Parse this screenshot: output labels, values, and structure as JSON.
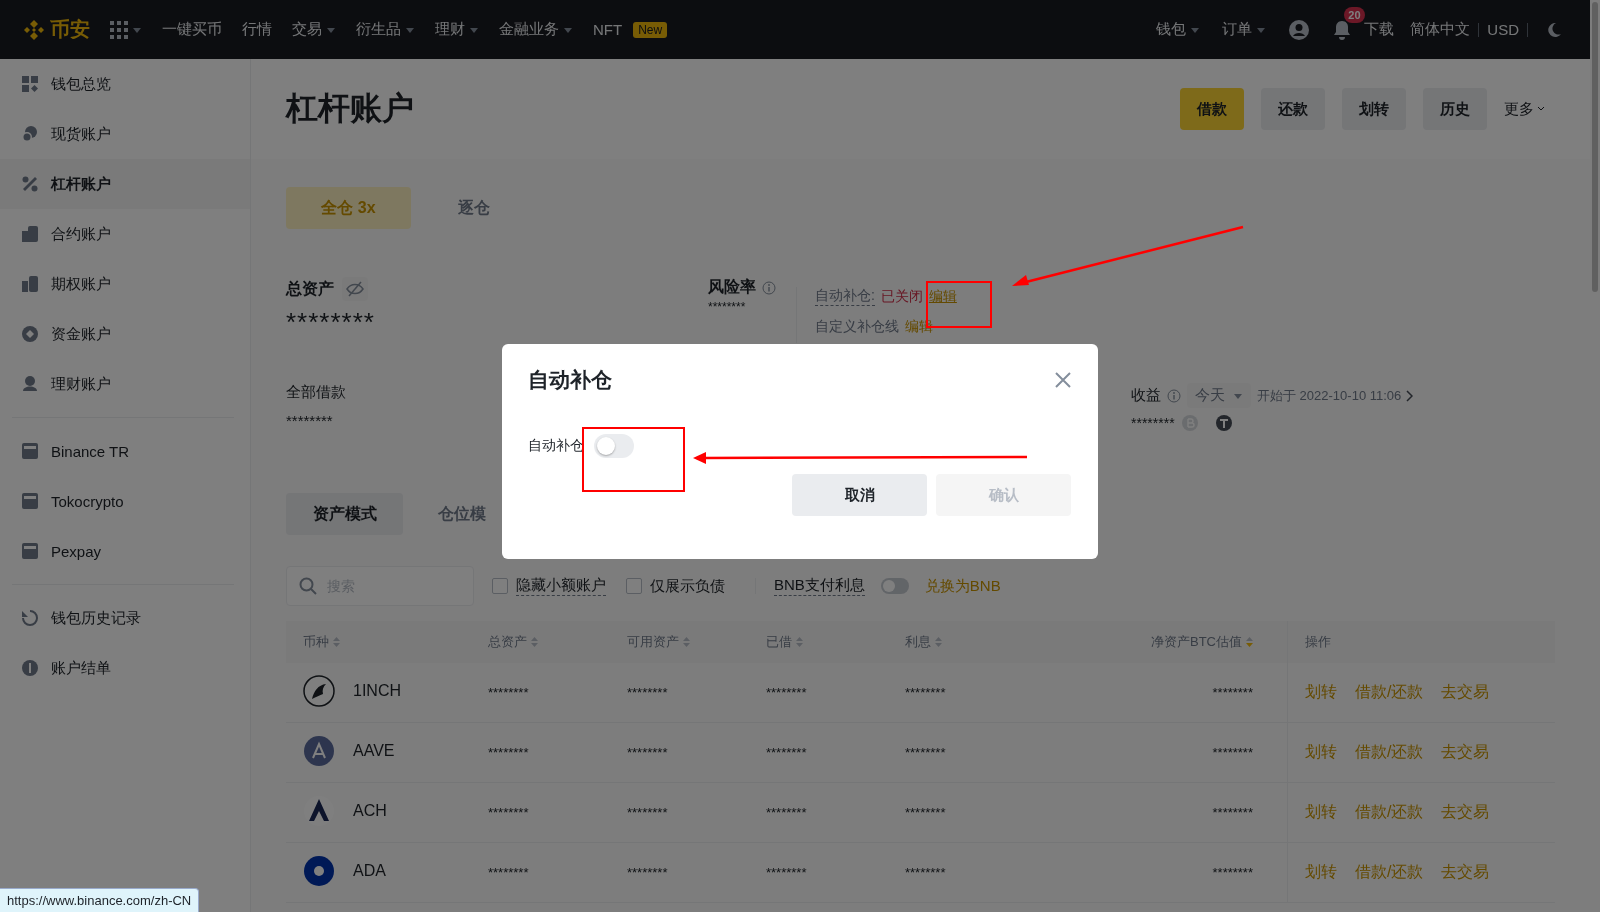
{
  "topbar": {
    "logo": "币安",
    "nav": [
      {
        "label": "一键买币",
        "dropdown": false
      },
      {
        "label": "行情",
        "dropdown": false
      },
      {
        "label": "交易",
        "dropdown": true
      },
      {
        "label": "衍生品",
        "dropdown": true
      },
      {
        "label": "理财",
        "dropdown": true
      },
      {
        "label": "金融业务",
        "dropdown": true
      }
    ],
    "nft": {
      "label": "NFT",
      "badge": "New"
    },
    "right_menus": [
      {
        "label": "钱包",
        "dropdown": true
      },
      {
        "label": "订单",
        "dropdown": true
      }
    ],
    "notifications": "20",
    "download": "下载",
    "language": "简体中文",
    "currency": "USD"
  },
  "sidebar": {
    "groups": [
      [
        {
          "label": "钱包总览",
          "selected": false
        },
        {
          "label": "现货账户",
          "selected": false
        },
        {
          "label": "杠杆账户",
          "selected": true
        },
        {
          "label": "合约账户",
          "selected": false
        },
        {
          "label": "期权账户",
          "selected": false
        },
        {
          "label": "资金账户",
          "selected": false
        },
        {
          "label": "理财账户",
          "selected": false
        }
      ],
      [
        {
          "label": "Binance TR",
          "selected": false
        },
        {
          "label": "Tokocrypto",
          "selected": false
        },
        {
          "label": "Pexpay",
          "selected": false
        }
      ],
      [
        {
          "label": "钱包历史记录",
          "selected": false
        },
        {
          "label": "账户结单",
          "selected": false
        }
      ]
    ]
  },
  "page": {
    "title": "杠杆账户",
    "actions": [
      {
        "label": "借款",
        "primary": true
      },
      {
        "label": "还款",
        "primary": false
      },
      {
        "label": "划转",
        "primary": false
      },
      {
        "label": "历史",
        "primary": false
      }
    ],
    "more": "更多"
  },
  "mode_tabs": [
    {
      "label": "全仓 3x",
      "selected": true
    },
    {
      "label": "逐仓",
      "selected": false
    }
  ],
  "summary": {
    "total_assets": {
      "label": "总资产",
      "value": "********"
    },
    "risk": {
      "label": "风险率",
      "value": "********"
    },
    "auto_topup": {
      "label": "自动补仓:",
      "status": "已关闭",
      "enabled": false,
      "edit": "编辑"
    },
    "custom_line": {
      "label": "自定义补仓线",
      "edit": "编辑"
    },
    "total_borrowed": {
      "label": "全部借款",
      "value": "********"
    },
    "pnl": {
      "label": "收益",
      "period": "今天",
      "since": "开始于 2022-10-10 11:06",
      "value": "********"
    }
  },
  "view_tabs": [
    {
      "label": "资产模式",
      "selected": true
    },
    {
      "label": "仓位模",
      "selected": false
    }
  ],
  "filters": {
    "search_placeholder": "搜索",
    "checks": [
      {
        "label": "隐藏小额账户",
        "checked": false
      },
      {
        "label": "仅展示负债",
        "checked": false
      }
    ],
    "bnb_interest": {
      "label": "BNB支付利息",
      "on": false
    },
    "convert": "兑换为BNB"
  },
  "table": {
    "columns": [
      {
        "label": "币种",
        "sort_active": false
      },
      {
        "label": "总资产",
        "sort_active": false
      },
      {
        "label": "可用资产",
        "sort_active": false
      },
      {
        "label": "已借",
        "sort_active": false
      },
      {
        "label": "利息",
        "sort_active": false
      },
      {
        "label": "净资产BTC估值",
        "sort_active": true
      }
    ],
    "action_column": "操作",
    "rows": [
      {
        "coin": "1INCH",
        "values": [
          "********",
          "********",
          "********",
          "********",
          "********"
        ],
        "actions": [
          "划转",
          "借款/还款",
          "去交易"
        ]
      },
      {
        "coin": "AAVE",
        "values": [
          "********",
          "********",
          "********",
          "********",
          "********"
        ],
        "actions": [
          "划转",
          "借款/还款",
          "去交易"
        ]
      },
      {
        "coin": "ACH",
        "values": [
          "********",
          "********",
          "********",
          "********",
          "********"
        ],
        "actions": [
          "划转",
          "借款/还款",
          "去交易"
        ]
      },
      {
        "coin": "ADA",
        "values": [
          "********",
          "********",
          "********",
          "********",
          "********"
        ],
        "actions": [
          "划转",
          "借款/还款",
          "去交易"
        ]
      }
    ]
  },
  "modal": {
    "title": "自动补仓",
    "field_label": "自动补仓",
    "toggle_on": false,
    "buttons": [
      {
        "label": "取消",
        "disabled": false
      },
      {
        "label": "确认",
        "disabled": true
      }
    ]
  },
  "status_url": "https://www.binance.com/zh-CN"
}
